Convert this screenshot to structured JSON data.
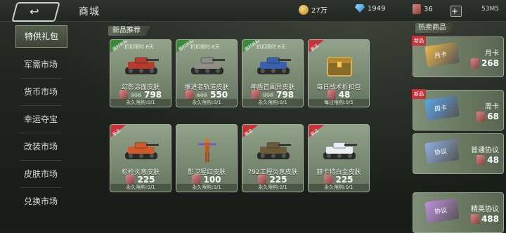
{
  "header": {
    "title": "商城",
    "gold": "27万",
    "diamonds": "1949",
    "tickets": "36",
    "status": "53M5"
  },
  "sidebar": {
    "items": [
      {
        "label": "特供礼包",
        "active": true
      },
      {
        "label": "军需市场"
      },
      {
        "label": "货币市场"
      },
      {
        "label": "幸运夺宝"
      },
      {
        "label": "改装市场"
      },
      {
        "label": "皮肤市场"
      },
      {
        "label": "兑换市场"
      }
    ]
  },
  "main": {
    "section_title": "新品推荐",
    "cards": [
      {
        "ribbon": "限时折扣",
        "ribbon_color": "#3a8a3a",
        "discount": "折扣限时:6天",
        "name": "幻影涂面皮肤",
        "old_price": "998",
        "price": "798",
        "limit": "永久限购:0/1",
        "art": "tank-red"
      },
      {
        "ribbon": "限时折扣",
        "ribbon_color": "#3a8a3a",
        "discount": "折扣限时:6天",
        "name": "推进者轨道皮肤",
        "old_price": "688",
        "price": "550",
        "limit": "永久限购:0/1",
        "art": "tank-gray"
      },
      {
        "ribbon": "限时折扣",
        "ribbon_color": "#3a8a3a",
        "discount": "折扣限时:6天",
        "name": "神盾首阖异皮肤",
        "old_price": "998",
        "price": "798",
        "limit": "永久限购:0/1",
        "art": "tank-blue"
      },
      {
        "ribbon": "新品",
        "ribbon_color": "#c8323a",
        "discount": "",
        "name": "每日战术折扣包",
        "old_price": "",
        "price": "48",
        "limit": "每日限购:0/5",
        "art": "chest"
      },
      {
        "ribbon": "新品",
        "ribbon_color": "#c8323a",
        "discount": "",
        "name": "标枪炎意皮肤",
        "old_price": "",
        "price": "225",
        "limit": "永久限购:0/1",
        "art": "tank-orange"
      },
      {
        "ribbon": "",
        "ribbon_color": "",
        "discount": "",
        "name": "影卫猩红皮肤",
        "old_price": "",
        "price": "100",
        "limit": "永久限购:0/1",
        "art": "figure"
      },
      {
        "ribbon": "新品",
        "ribbon_color": "#c8323a",
        "discount": "",
        "name": "792工程炎意皮肤",
        "old_price": "",
        "price": "225",
        "limit": "永久限购:0/1",
        "art": "tank-dark"
      },
      {
        "ribbon": "新品",
        "ribbon_color": "#c8323a",
        "discount": "",
        "name": "赫卡特白金皮肤",
        "old_price": "",
        "price": "225",
        "limit": "永久限购:0/1",
        "art": "tank-white"
      }
    ]
  },
  "right": {
    "section_title": "热卖商品",
    "items": [
      {
        "badge": "新品",
        "label": "月卡",
        "price": "268",
        "icon_color": "#e9b64a",
        "icon_text": "月卡"
      },
      {
        "badge": "新品",
        "label": "周卡",
        "price": "68",
        "icon_color": "#5aa7e6",
        "icon_text": "周卡"
      },
      {
        "badge": "",
        "label": "普通协议",
        "price": "48",
        "icon_color": "#8fb0e0",
        "icon_text": "协议"
      },
      {
        "badge": "",
        "label": "精英协议",
        "price": "488",
        "icon_color": "#c28fe0",
        "icon_text": "协议"
      }
    ]
  }
}
